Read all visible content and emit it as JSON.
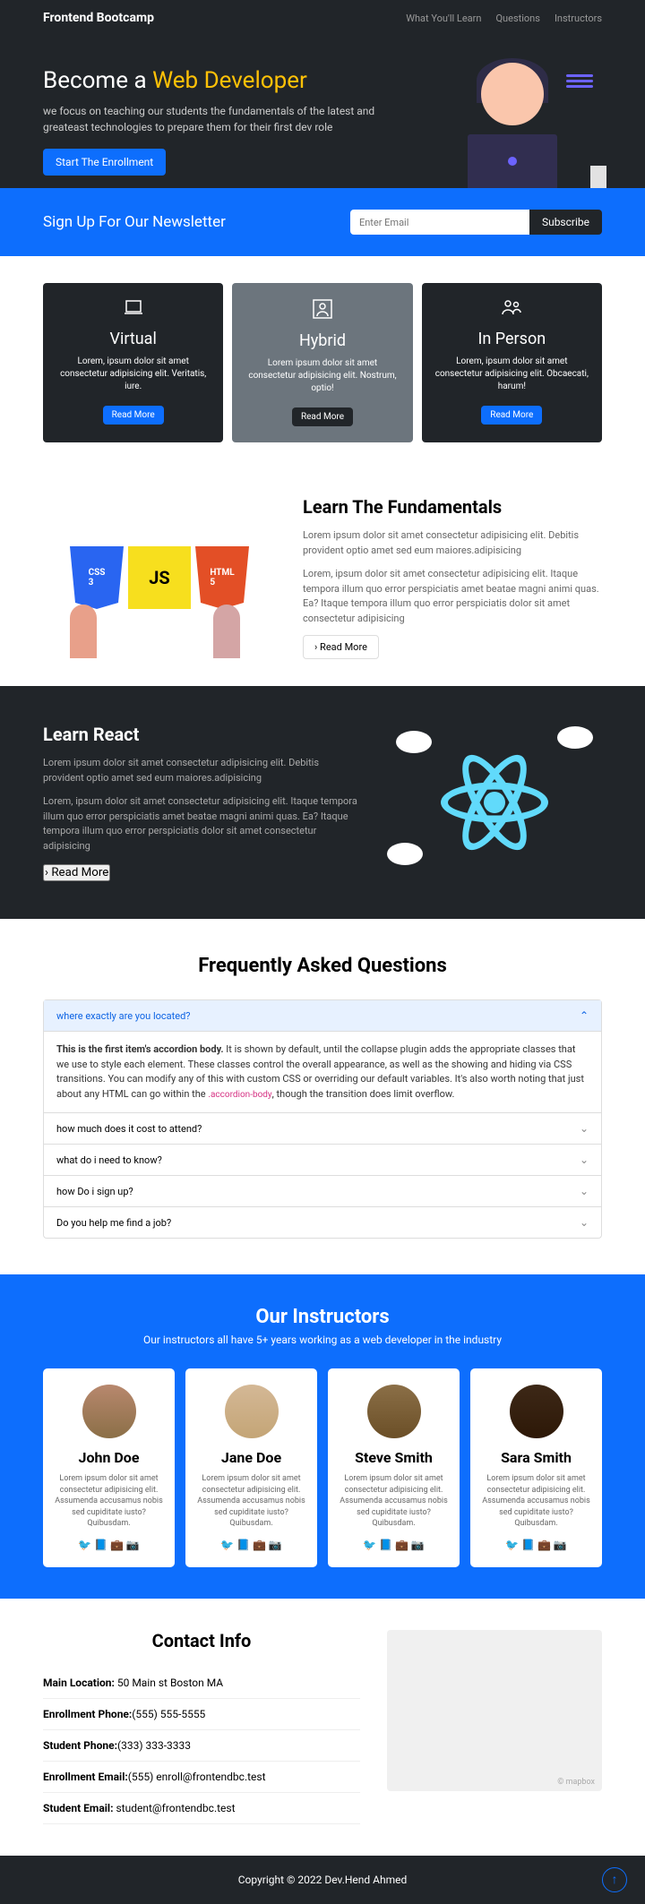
{
  "nav": {
    "brand": "Frontend Bootcamp",
    "links": [
      "What You'll Learn",
      "Questions",
      "Instructors"
    ]
  },
  "hero": {
    "title_a": "Become a ",
    "title_b": "Web Developer",
    "text": "we focus on teaching our students the fundamentals of the latest and greateast technologies to prepare them for their first dev role",
    "cta": "Start The Enrollment"
  },
  "newsletter": {
    "title": "Sign Up For Our Newsletter",
    "placeholder": "Enter Email",
    "button": "Subscribe"
  },
  "boxes": [
    {
      "icon": "💻",
      "title": "Virtual",
      "text": "Lorem, ipsum dolor sit amet consectetur adipisicing elit. Veritatis, iure.",
      "btn": "Read More"
    },
    {
      "icon": "👤",
      "title": "Hybrid",
      "text": "Lorem ipsum dolor sit amet consectetur adipisicing elit. Nostrum, optio!",
      "btn": "Read More"
    },
    {
      "icon": "👥",
      "title": "In Person",
      "text": "Lorem, ipsum dolor sit amet consectetur adipisicing elit. Obcaecati, harum!",
      "btn": "Read More"
    }
  ],
  "learn1": {
    "title": "Learn The Fundamentals",
    "p1": "Lorem ipsum dolor sit amet consectetur adipisicing elit. Debitis provident optio amet sed eum maiores.adipisicing",
    "p2": "Lorem, ipsum dolor sit amet consectetur adipisicing elit. Itaque tempora illum quo error perspiciatis amet beatae magni animi quas. Ea? Itaque tempora illum quo error perspiciatis dolor sit amet consectetur adipisicing",
    "btn": "Read More"
  },
  "learn2": {
    "title": "Learn React",
    "p1": "Lorem ipsum dolor sit amet consectetur adipisicing elit. Debitis provident optio amet sed eum maiores.adipisicing",
    "p2": "Lorem, ipsum dolor sit amet consectetur adipisicing elit. Itaque tempora illum quo error perspiciatis amet beatae magni animi quas. Ea? Itaque tempora illum quo error perspiciatis dolor sit amet consectetur adipisicing",
    "btn": "Read More"
  },
  "faq": {
    "title": "Frequently Asked Questions",
    "items": [
      {
        "q": "where exactly are you located?",
        "open": true
      },
      {
        "q": "how much does it cost to attend?"
      },
      {
        "q": "what do i need to know?"
      },
      {
        "q": "how Do i sign up?"
      },
      {
        "q": "Do you help me find a job?"
      }
    ],
    "body_strong": "This is the first item's accordion body.",
    "body_text": " It is shown by default, until the collapse plugin adds the appropriate classes that we use to style each element. These classes control the overall appearance, as well as the showing and hiding via CSS transitions. You can modify any of this with custom CSS or overriding our default variables. It's also worth noting that just about any HTML can go within the ",
    "body_code": ".accordion-body",
    "body_end": ", though the transition does limit overflow."
  },
  "instructors": {
    "title": "Our Instructors",
    "lead": "Our instructors all have 5+ years working as a web developer in the industry",
    "bio": "Lorem ipsum dolor sit amet consectetur adipisicing elit. Assumenda accusamus nobis sed cupiditate iusto? Quibusdam.",
    "list": [
      {
        "name": "John Doe",
        "color": "#B8886E"
      },
      {
        "name": "Jane Doe",
        "color": "#D4B896"
      },
      {
        "name": "Steve Smith",
        "color": "#8B6F47"
      },
      {
        "name": "Sara Smith",
        "color": "#3D2817"
      }
    ]
  },
  "contact": {
    "title": "Contact Info",
    "items": [
      {
        "label": "Main Location:",
        "value": " 50 Main st Boston MA"
      },
      {
        "label": "Enrollment Phone:",
        "value": "(555) 555-5555"
      },
      {
        "label": "Student Phone:",
        "value": "(333) 333-3333"
      },
      {
        "label": "Enrollment Email:",
        "value": "(555) enroll@frontendbc.test"
      },
      {
        "label": "Student Email:",
        "value": " student@frontendbc.test"
      }
    ],
    "map_attr": "© mapbox"
  },
  "footer": {
    "text": "Copyright © 2022 Dev.Hend Ahmed"
  }
}
